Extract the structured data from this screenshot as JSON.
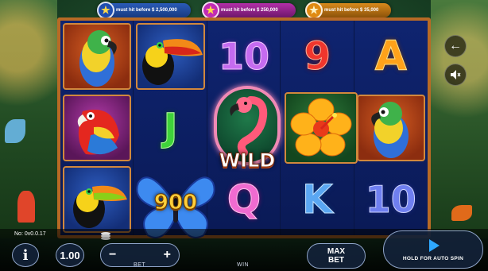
{
  "jackpots": [
    {
      "name": "jackpot-blue",
      "text": "must hit before $ 2,500,000"
    },
    {
      "name": "jackpot-pink",
      "text": "must hit before $ 250,000"
    },
    {
      "name": "jackpot-orange",
      "text": "must hit before $ 35,000"
    }
  ],
  "reels": {
    "symbols": {
      "col1": [
        "macaw",
        "scarlet-macaw",
        "toucan"
      ],
      "col2": [
        "toucan",
        "J",
        "blue-butterfly"
      ],
      "col3": [
        "10",
        "flamingo-wild",
        "Q"
      ],
      "col4": [
        "9",
        "hibiscus",
        "K"
      ],
      "col5": [
        "A",
        "macaw",
        "10"
      ]
    },
    "labels": {
      "ten": "10",
      "nine": "9",
      "ace": "A",
      "jack": "J",
      "queen": "Q",
      "king": "K",
      "ten_b": "10"
    },
    "wild_label": "WILD",
    "win_amount": "900"
  },
  "side": {
    "back_icon": "back-arrow-icon",
    "sound_icon": "sound-muted-icon"
  },
  "bottom": {
    "version": "No: 0v0.0.17",
    "info_label": "i",
    "denomination": "1.00",
    "bet_minus": "−",
    "bet_plus": "+",
    "bet_label": "BET",
    "win_label": "WIN",
    "max_bet_line1": "MAX",
    "max_bet_line2": "BET",
    "auto_spin_label": "HOLD FOR AUTO SPIN"
  },
  "colors": {
    "frame": "#b86a25",
    "reel_bg": "#0b1a55",
    "win_gold": "#ffcf3a"
  }
}
